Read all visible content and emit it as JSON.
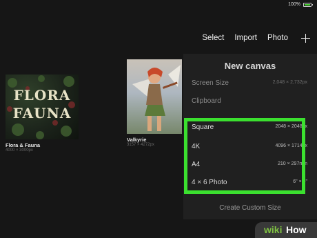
{
  "status": {
    "battery_text": "100%"
  },
  "toolbar": {
    "select": "Select",
    "import": "Import",
    "photo": "Photo"
  },
  "gallery": [
    {
      "title": "Flora & Fauna",
      "dims": "4000 × 3000px",
      "art_line1": "FLORA",
      "art_line2": "FAUNA"
    },
    {
      "title": "Valkyrie",
      "dims": "3157 × 4272px"
    }
  ],
  "panel": {
    "title": "New canvas",
    "rows": [
      {
        "label": "Screen Size",
        "value": "2,048 × 2,732px"
      },
      {
        "label": "Clipboard",
        "value": ""
      },
      {
        "label": "Square",
        "value": "2048 × 2048px"
      },
      {
        "label": "4K",
        "value": "4096 × 1714px"
      },
      {
        "label": "A4",
        "value": "210 × 297mm"
      },
      {
        "label": "4 × 6 Photo",
        "value": "6\" × 4\""
      }
    ],
    "custom": "Create Custom Size"
  },
  "watermark": {
    "part1": "wiki",
    "part2": "How"
  },
  "colors": {
    "highlight": "#3be02f",
    "background": "#161616",
    "panel": "#202020"
  }
}
